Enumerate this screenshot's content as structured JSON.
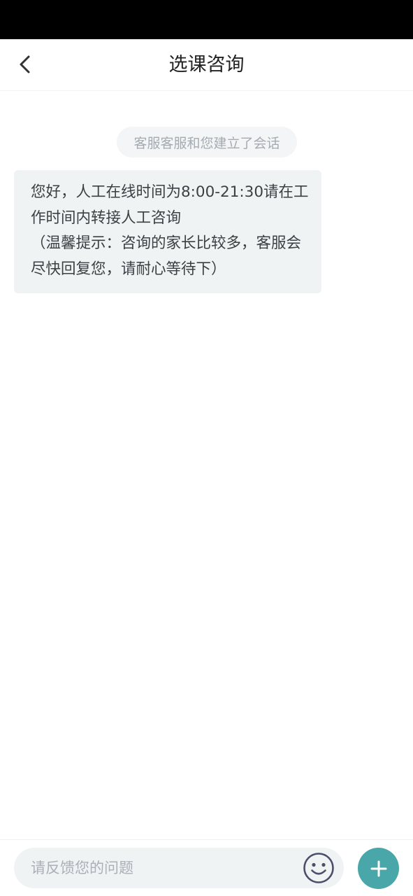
{
  "header": {
    "title": "选课咨询",
    "back_icon": "chevron-left-icon"
  },
  "chat": {
    "system_note": "客服客服和您建立了会话",
    "messages": [
      {
        "sender": "agent",
        "text": "您好，人工在线时间为8:00-21:30请在工作时间内转接人工咨询\n（温馨提示：咨询的家长比较多，客服会尽快回复您，请耐心等待下）"
      }
    ]
  },
  "input": {
    "placeholder": "请反馈您的问题",
    "value": "",
    "emoji_icon": "smiley-face-icon",
    "plus_icon": "plus-icon"
  },
  "colors": {
    "accent": "#4aa7a9",
    "bubble_bg": "#eff3f4",
    "status_bar": "#000000"
  }
}
